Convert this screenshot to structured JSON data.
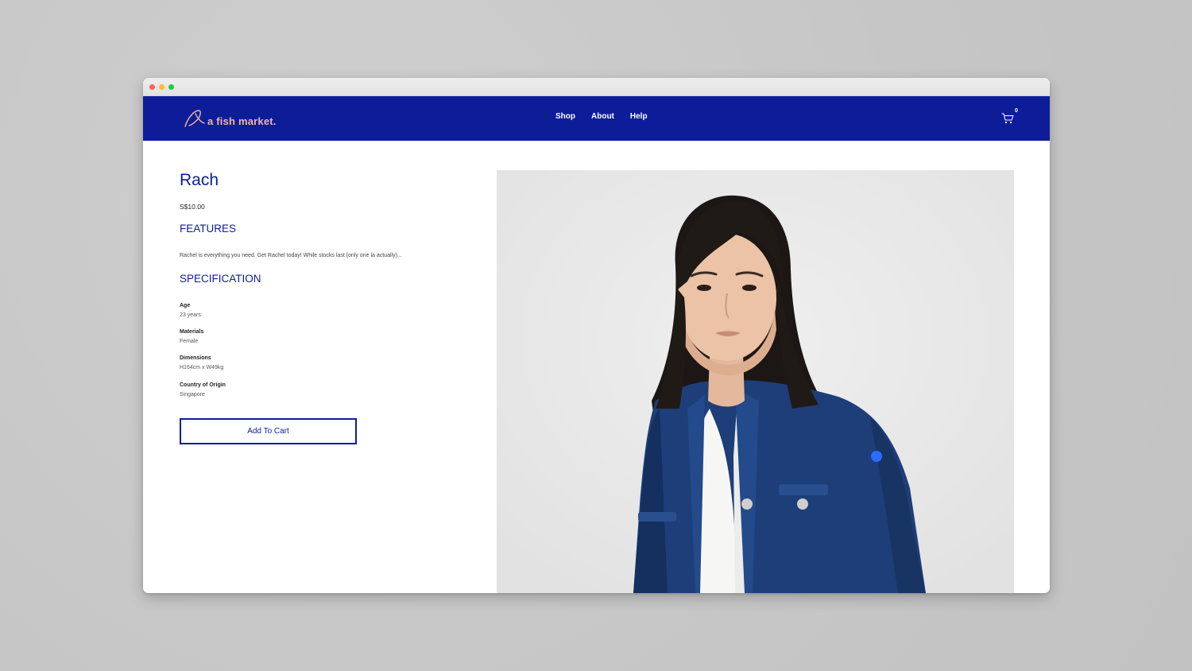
{
  "brand": {
    "name": "a fish market.",
    "logo_color": "#f4b4a0"
  },
  "nav": {
    "items": [
      "Shop",
      "About",
      "Help"
    ],
    "cart_count": "0",
    "bg_color": "#0d1d9a"
  },
  "product": {
    "title": "Rach",
    "price": "S$10.00",
    "features_heading": "FEATURES",
    "description": "Rachel is everything you need. Get Rachel today! While stocks last (only one la actually)...",
    "spec_heading": "SPECIFICATION",
    "specs": [
      {
        "label": "Age",
        "value": "23 years"
      },
      {
        "label": "Materials",
        "value": "Female"
      },
      {
        "label": "Dimensions",
        "value": "H164cm x W49kg"
      },
      {
        "label": "Country of Origin",
        "value": "Singapore"
      }
    ],
    "add_to_cart_label": "Add To Cart"
  }
}
